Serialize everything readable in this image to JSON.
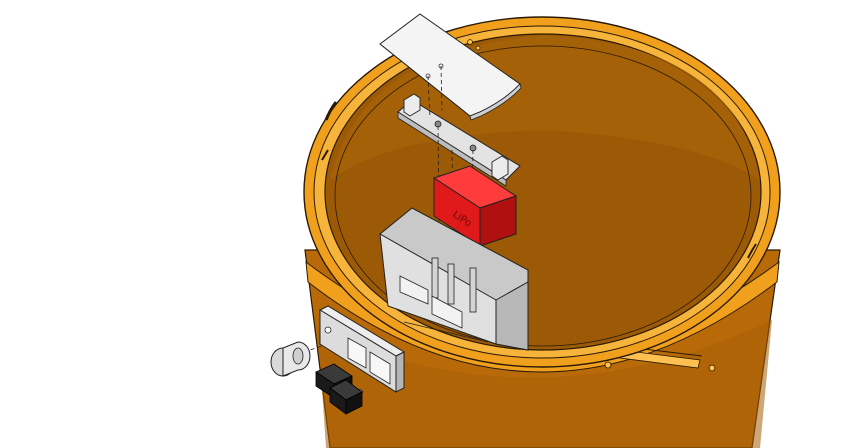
{
  "diagram": {
    "kind": "exploded-assembly-view",
    "background": "#ffffff",
    "colors": {
      "bucket_body": "#b86a08",
      "bucket_inner": "#9c5a06",
      "bucket_rim": "#f0a01c",
      "bucket_edge": "#2a1a05",
      "part_grey": "#d6d6d6",
      "part_grey_dark": "#a9a9a9",
      "battery_red": "#e01a1a",
      "battery_red_dark": "#b01010",
      "connector_black": "#1a1a1a",
      "lid_white": "#f4f4f4"
    },
    "parts": [
      {
        "id": "lid-plate",
        "color": "lid_white"
      },
      {
        "id": "mounting-rail",
        "color": "part_grey"
      },
      {
        "id": "battery-block",
        "color": "battery_red",
        "label": "LiPo"
      },
      {
        "id": "electronics-housing",
        "color": "part_grey"
      },
      {
        "id": "switch-panel",
        "color": "part_grey"
      },
      {
        "id": "knob",
        "color": "part_grey"
      },
      {
        "id": "connectors",
        "color": "connector_black"
      },
      {
        "id": "bucket",
        "color": "bucket_body"
      }
    ]
  }
}
